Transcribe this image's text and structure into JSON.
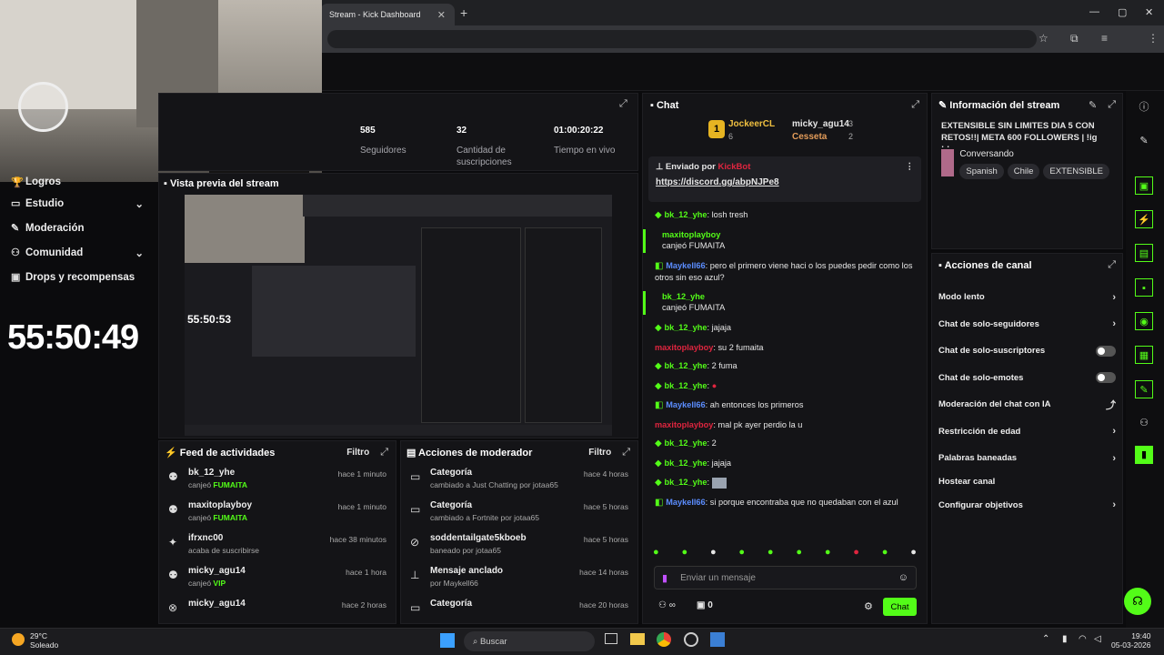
{
  "browser": {
    "tab_title": "Stream - Kick Dashboard",
    "new_tab": "+",
    "close": "✕",
    "minimize": "—",
    "maximize": "▢",
    "window_close": "✕"
  },
  "nav": {
    "items": [
      {
        "label": "Logros",
        "icon": "trophy-icon"
      },
      {
        "label": "Estudio",
        "icon": "studio-icon",
        "chevron": "⌄"
      },
      {
        "label": "Moderación",
        "icon": "wrench-icon"
      },
      {
        "label": "Comunidad",
        "icon": "community-icon",
        "chevron": "⌄"
      },
      {
        "label": "Drops y recompensas",
        "icon": "gift-icon"
      }
    ]
  },
  "timer": "55:50:49",
  "stats": [
    {
      "value": "585",
      "label": "Seguidores"
    },
    {
      "value": "32",
      "label": "Cantidad de suscripciones"
    },
    {
      "value": "01:00:20:22",
      "label": "Tiempo en vivo"
    }
  ],
  "preview": {
    "title": "Vista previa del stream",
    "timer": "55:50:53"
  },
  "feed": {
    "title": "Feed de actividades",
    "filter": "Filtro",
    "items": [
      {
        "name": "bk_12_yhe",
        "sub_pre": "canjeó ",
        "sub_hl": "FUMAITA",
        "time": "hace 1 minuto"
      },
      {
        "name": "maxitoplayboy",
        "sub_pre": "canjeó ",
        "sub_hl": "FUMAITA",
        "time": "hace 1 minuto"
      },
      {
        "name": "ifrxnc00",
        "sub_pre": "acaba de suscribirse",
        "sub_hl": "",
        "time": "hace 38 minutos"
      },
      {
        "name": "micky_agu14",
        "sub_pre": "canjeó ",
        "sub_hl": "VIP",
        "time": "hace 1 hora"
      },
      {
        "name": "micky_agu14",
        "sub_pre": "",
        "sub_hl": "",
        "time": "hace 2 horas"
      }
    ]
  },
  "mods": {
    "title": "Acciones de moderador",
    "filter": "Filtro",
    "items": [
      {
        "name": "Categoría",
        "sub": "cambiado a Just Chatting por jotaa65",
        "time": "hace 4 horas"
      },
      {
        "name": "Categoría",
        "sub": "cambiado a Fortnite por jotaa65",
        "time": "hace 5 horas"
      },
      {
        "name": "soddentailgate5kboeb",
        "sub": "baneado por jotaa65",
        "time": "hace 5 horas"
      },
      {
        "name": "Mensaje anclado",
        "sub": "por Maykell66",
        "time": "hace 14 horas"
      },
      {
        "name": "Categoría",
        "sub": "",
        "time": "hace 20 horas"
      }
    ]
  },
  "chat": {
    "title": "Chat",
    "leaders": [
      {
        "name": "JockeerCL",
        "count": "6"
      },
      {
        "name": "micky_agu14",
        "count": "3"
      },
      {
        "name": "Cesseta",
        "count": "2"
      }
    ],
    "pinned_by": "Enviado por",
    "pinned_user": "KickBot",
    "pinned_link": "https://discord.gg/abpNJPe8",
    "messages": [
      {
        "user": "bk_12_yhe",
        "color": "green",
        "text": "losh tresh"
      },
      {
        "user": "maxitoplayboy",
        "color": "green",
        "text": "canjeó FUMAITA",
        "redeem": true
      },
      {
        "user": "Maykell66",
        "color": "blue",
        "text": "pero el primero viene haci o los puedes pedir como los otros sin eso azul?"
      },
      {
        "user": "bk_12_yhe",
        "color": "green",
        "text": "canjeó FUMAITA",
        "redeem": true
      },
      {
        "user": "bk_12_yhe",
        "color": "green",
        "text": "jajaja"
      },
      {
        "user": "maxitoplayboy",
        "color": "red",
        "text": "su 2 fumaita"
      },
      {
        "user": "bk_12_yhe",
        "color": "green",
        "text": "2 fuma"
      },
      {
        "user": "bk_12_yhe",
        "color": "green",
        "text": ""
      },
      {
        "user": "Maykell66",
        "color": "blue",
        "text": "ah entonces los primeros"
      },
      {
        "user": "maxitoplayboy",
        "color": "red",
        "text": "mal pk ayer perdio la u"
      },
      {
        "user": "bk_12_yhe",
        "color": "green",
        "text": "2"
      },
      {
        "user": "bk_12_yhe",
        "color": "green",
        "text": "jajaja"
      },
      {
        "user": "bk_12_yhe",
        "color": "green",
        "text": ""
      },
      {
        "user": "Maykell66",
        "color": "blue",
        "text": "si porque encontraba que no quedaban con el azul"
      }
    ],
    "input_placeholder": "Enviar un mensaje",
    "points": "0",
    "send": "Chat"
  },
  "info": {
    "title": "Información del stream",
    "stream_title": "EXTENSIBLE SIN LIMITES DIA 5 CON RETOS!!| META 600 FOLLOWERS | !ig !d...",
    "category": "Conversando",
    "tags": [
      "Spanish",
      "Chile",
      "EXTENSIBLE"
    ]
  },
  "actions": {
    "title": "Acciones de canal",
    "items": [
      {
        "label": "Modo lento",
        "kind": "chevron"
      },
      {
        "label": "Chat de solo-seguidores",
        "kind": "chevron"
      },
      {
        "label": "Chat de solo-suscriptores",
        "kind": "toggle"
      },
      {
        "label": "Chat de solo-emotes",
        "kind": "toggle"
      },
      {
        "label": "Moderación del chat con IA",
        "kind": "external"
      },
      {
        "label": "Restricción de edad",
        "kind": "chevron"
      },
      {
        "label": "Palabras baneadas",
        "kind": "chevron"
      },
      {
        "label": "Hostear canal",
        "kind": "none"
      },
      {
        "label": "Configurar objetivos",
        "kind": "chevron"
      }
    ]
  },
  "taskbar": {
    "temp": "29°C",
    "weather": "Soleado",
    "search": "Buscar",
    "time": "19:40",
    "date": "05-03-2026"
  },
  "colors": {
    "accent": "#53fc18",
    "bg": "#0b0b0d",
    "panel": "#141417"
  }
}
